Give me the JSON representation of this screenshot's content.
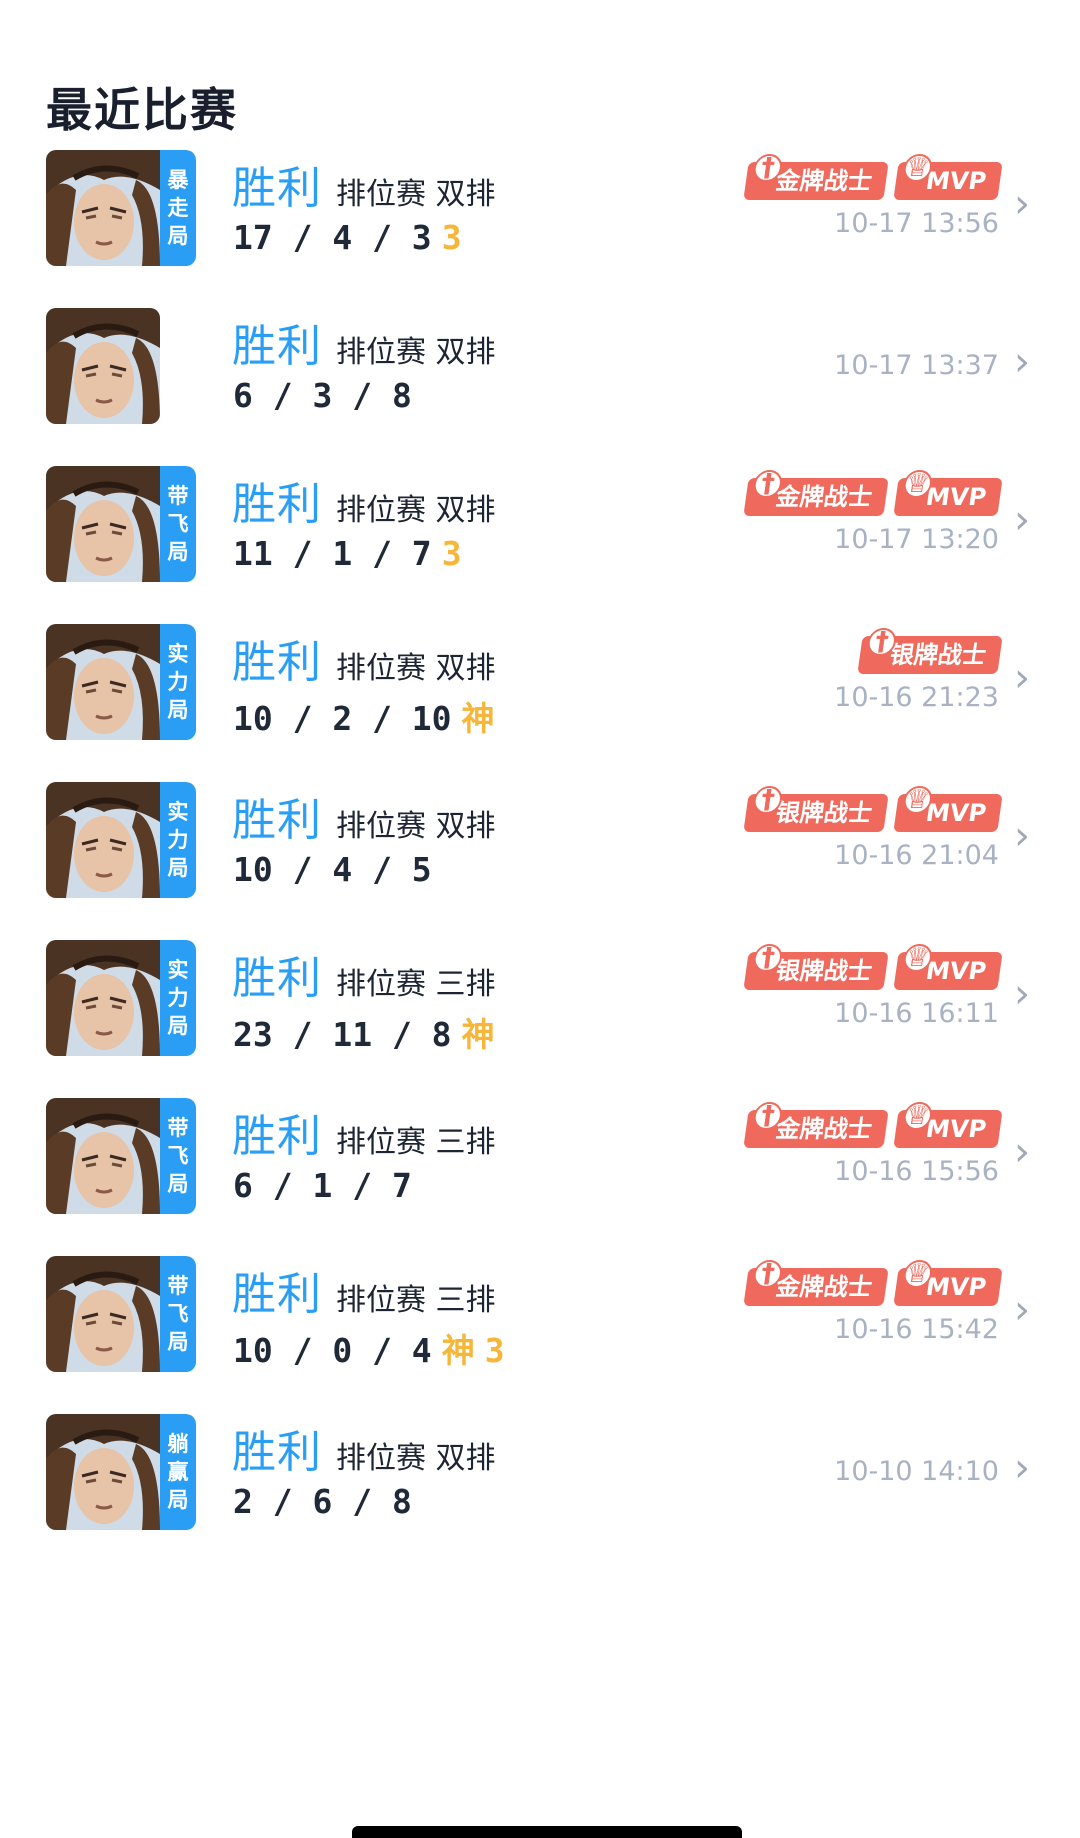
{
  "page": {
    "title": "最近比赛"
  },
  "colors": {
    "accent": "#2a9ef5",
    "badge": "#ef6a5c",
    "flag": "#f5b63a",
    "muted": "#a9b2c3"
  },
  "icons": {
    "chevron": "chevron-right-icon",
    "badge_sword": "sword-icon",
    "badge_trophy": "trophy-icon"
  },
  "matches": [
    {
      "tag": [
        "暴",
        "走",
        "局"
      ],
      "result": "胜利",
      "mode": "排位赛 双排",
      "kda": "17 / 4 / 3",
      "flags": [
        "3"
      ],
      "badges": [
        "金牌战士",
        "MVP"
      ],
      "time": "10-17 13:56"
    },
    {
      "tag": [],
      "result": "胜利",
      "mode": "排位赛 双排",
      "kda": "6 / 3 / 8",
      "flags": [],
      "badges": [],
      "time": "10-17 13:37"
    },
    {
      "tag": [
        "带",
        "飞",
        "局"
      ],
      "result": "胜利",
      "mode": "排位赛 双排",
      "kda": "11 / 1 / 7",
      "flags": [
        "3"
      ],
      "badges": [
        "金牌战士",
        "MVP"
      ],
      "time": "10-17 13:20"
    },
    {
      "tag": [
        "实",
        "力",
        "局"
      ],
      "result": "胜利",
      "mode": "排位赛 双排",
      "kda": "10 / 2 / 10",
      "flags": [
        "神"
      ],
      "badges": [
        "银牌战士"
      ],
      "time": "10-16 21:23"
    },
    {
      "tag": [
        "实",
        "力",
        "局"
      ],
      "result": "胜利",
      "mode": "排位赛 双排",
      "kda": "10 / 4 / 5",
      "flags": [],
      "badges": [
        "银牌战士",
        "MVP"
      ],
      "time": "10-16 21:04"
    },
    {
      "tag": [
        "实",
        "力",
        "局"
      ],
      "result": "胜利",
      "mode": "排位赛 三排",
      "kda": "23 / 11 / 8",
      "flags": [
        "神"
      ],
      "badges": [
        "银牌战士",
        "MVP"
      ],
      "time": "10-16 16:11"
    },
    {
      "tag": [
        "带",
        "飞",
        "局"
      ],
      "result": "胜利",
      "mode": "排位赛 三排",
      "kda": "6 / 1 / 7",
      "flags": [],
      "badges": [
        "金牌战士",
        "MVP"
      ],
      "time": "10-16 15:56"
    },
    {
      "tag": [
        "带",
        "飞",
        "局"
      ],
      "result": "胜利",
      "mode": "排位赛 三排",
      "kda": "10 / 0 / 4",
      "flags": [
        "神",
        "3"
      ],
      "badges": [
        "金牌战士",
        "MVP"
      ],
      "time": "10-16 15:42"
    },
    {
      "tag": [
        "躺",
        "赢",
        "局"
      ],
      "result": "胜利",
      "mode": "排位赛 双排",
      "kda": "2 / 6 / 8",
      "flags": [],
      "badges": [],
      "time": "10-10 14:10"
    }
  ]
}
